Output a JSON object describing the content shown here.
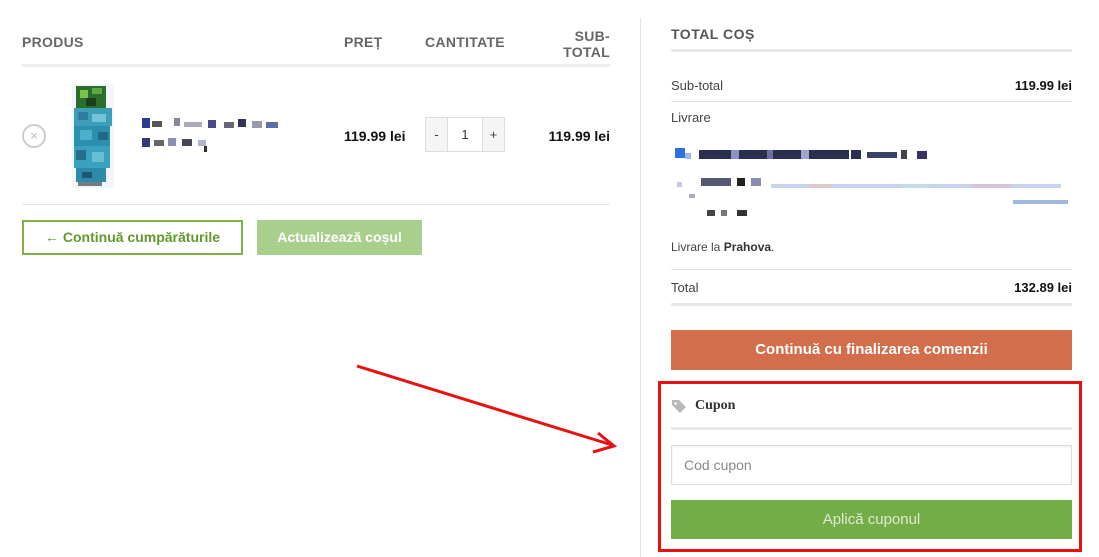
{
  "cart": {
    "headers": {
      "product": "PRODUS",
      "price": "PREȚ",
      "quantity": "CANTITATE",
      "subtotal_line1": "SUB-",
      "subtotal_line2": "TOTAL"
    },
    "item": {
      "remove": "×",
      "price": "119.99 lei",
      "quantity": "1",
      "subtotal": "119.99 lei",
      "qty_minus": "-",
      "qty_plus": "+"
    },
    "continue_shopping": "← Continuă cumpărăturile",
    "update_cart": "Actualizează coșul"
  },
  "totals": {
    "title": "TOTAL COȘ",
    "subtotal_label": "Sub-total",
    "subtotal_value": "119.99 lei",
    "shipping_label": "Livrare",
    "shipping_dest_prefix": "Livrare la ",
    "shipping_dest_region": "Prahova",
    "shipping_dest_suffix": ".",
    "total_label": "Total",
    "total_value": "132.89 lei",
    "checkout_button": "Continuă cu finalizarea comenzii"
  },
  "coupon": {
    "title": "Cupon",
    "input_placeholder": "Cod cupon",
    "apply_button": "Aplică cuponul"
  },
  "colors": {
    "accent_green": "#72ad45",
    "checkout_orange": "#d26e4b",
    "highlight_red": "#e81010"
  }
}
